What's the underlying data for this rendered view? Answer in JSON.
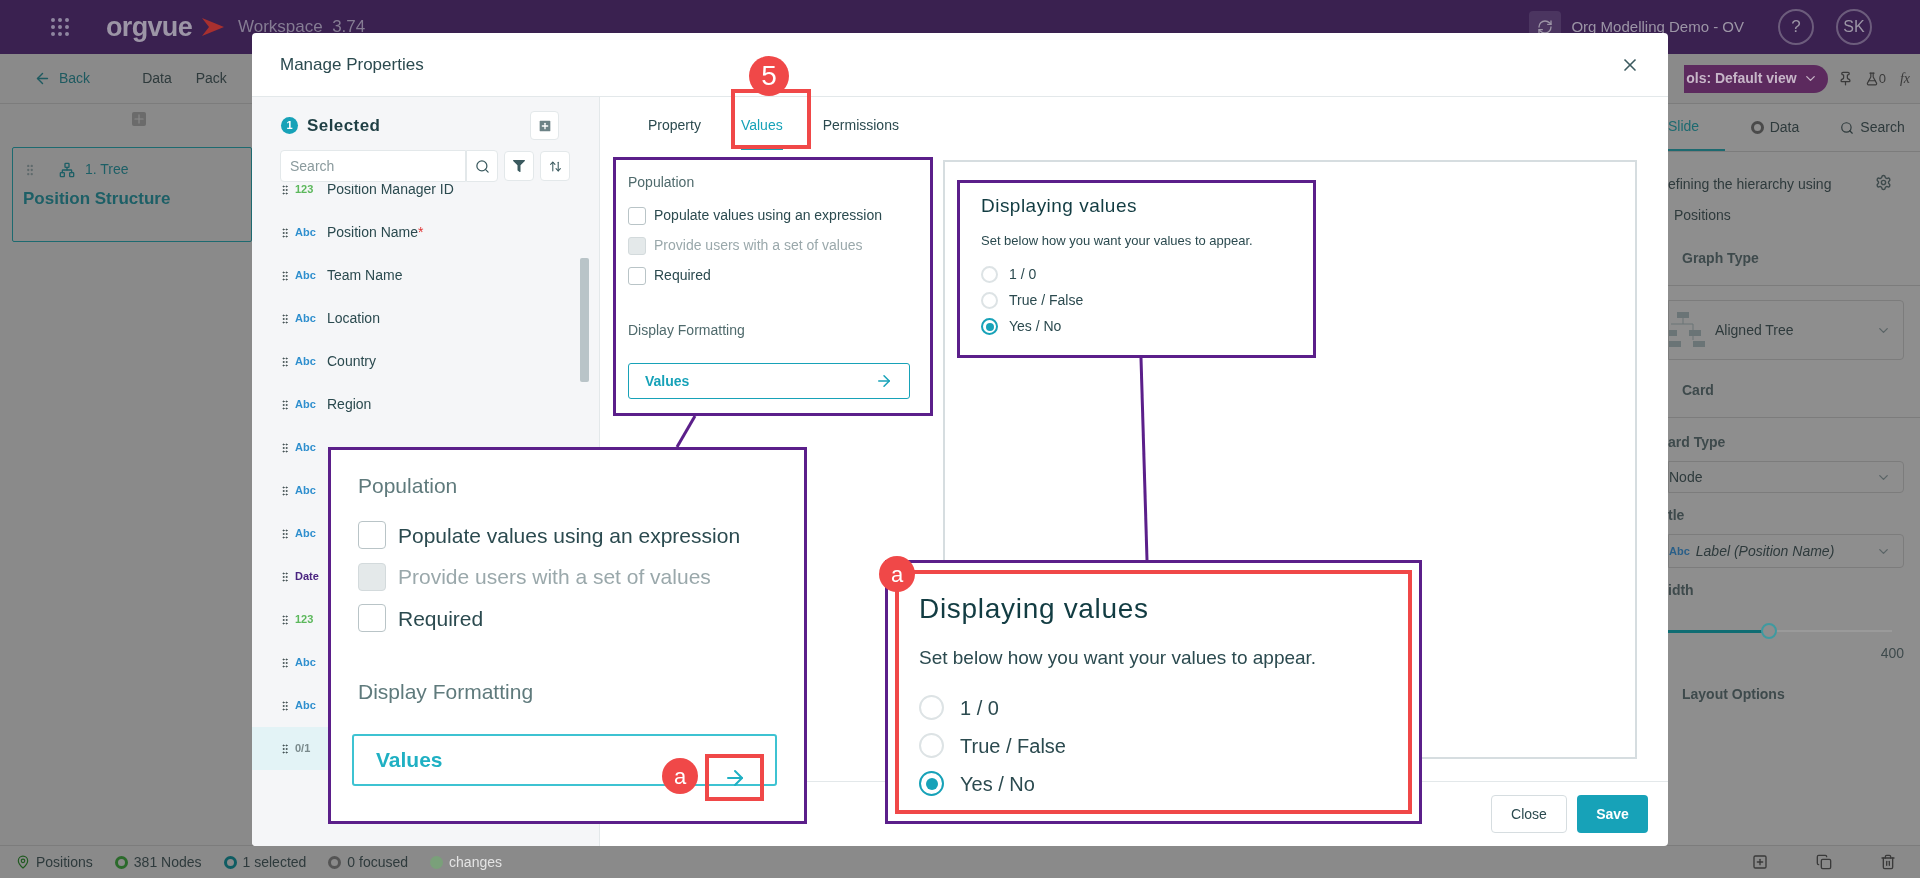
{
  "top_bar": {
    "logo": "orgvue",
    "workspace": "Workspace  3.74",
    "project": "Org Modelling Demo - OV",
    "help": "?",
    "avatar": "SK"
  },
  "toolbar": {
    "back": "Back",
    "menu": [
      "Data",
      "Pack"
    ],
    "view": "ols: Default view",
    "alerts": "0",
    "formula": "fx"
  },
  "canvas": {
    "card": {
      "title": "1. Tree",
      "name": "Position Structure"
    }
  },
  "right_panel": {
    "tabs": [
      {
        "label": "Slide",
        "selected": true
      },
      {
        "label": "Data",
        "selected": false
      },
      {
        "label": "Search",
        "selected": false
      }
    ],
    "hierarchy_text": "efining the hierarchy using",
    "hierarchy_value": "Positions",
    "graph_heading": "Graph Type",
    "graph_type": "Aligned Tree",
    "card_heading": "Card",
    "card_type_label": "ard Type",
    "card_type": "Node",
    "title_label": "tle",
    "title_tag": "Abc",
    "title_value": "Label (Position Name)",
    "width_label": "idth",
    "width": {
      "level": 0.45,
      "reading": "400"
    },
    "layout_heading": "Layout Options"
  },
  "status_bar": [
    {
      "kind": "positions",
      "label": "Positions",
      "disabled": false
    },
    {
      "kind": "nodes",
      "label": "381 Nodes",
      "disabled": false
    },
    {
      "kind": "selected",
      "label": "1 selected",
      "disabled": false
    },
    {
      "kind": "focused",
      "label": "0 focused",
      "disabled": false
    },
    {
      "kind": "changes",
      "label": "changes",
      "disabled": true
    }
  ],
  "modal": {
    "title": "Manage Properties",
    "selected_count": "1",
    "selected_label": "Selected",
    "search": {
      "placeholder": "Search"
    },
    "properties": [
      {
        "kind": "number",
        "type": "123",
        "name": "Position Manager ID",
        "selected": false
      },
      {
        "kind": "text",
        "type": "Abc",
        "name": "Position Name",
        "marker": "*",
        "selected": false
      },
      {
        "kind": "text",
        "type": "Abc",
        "name": "Team Name",
        "selected": false
      },
      {
        "kind": "text",
        "type": "Abc",
        "name": "Location",
        "selected": false
      },
      {
        "kind": "text",
        "type": "Abc",
        "name": "Country",
        "selected": false
      },
      {
        "kind": "text",
        "type": "Abc",
        "name": "Region",
        "selected": false
      },
      {
        "kind": "text",
        "type": "Abc",
        "selected": false
      },
      {
        "kind": "text",
        "type": "Abc",
        "selected": false
      },
      {
        "kind": "text",
        "type": "Abc",
        "selected": false
      },
      {
        "kind": "date",
        "type": "Date",
        "selected": false
      },
      {
        "kind": "number",
        "type": "123",
        "selected": false
      },
      {
        "kind": "text",
        "type": "Abc",
        "selected": false
      },
      {
        "kind": "text",
        "type": "Abc",
        "selected": false
      },
      {
        "kind": "boolean",
        "type": "0/1",
        "selected": true
      }
    ],
    "tabs": [
      {
        "label": "Property",
        "selected": false
      },
      {
        "label": "Values",
        "selected": true
      },
      {
        "label": "Permissions",
        "selected": false
      }
    ],
    "population": {
      "heading": "Population",
      "options": [
        {
          "label": "Populate values using an expression",
          "checked": false,
          "disabled": false
        },
        {
          "label": "Provide users with a set of values",
          "checked": false,
          "disabled": true
        },
        {
          "label": "Required",
          "checked": false,
          "disabled": false
        }
      ]
    },
    "formatting": {
      "heading": "Display Formatting",
      "button": "Values"
    },
    "display": {
      "title": "Displaying values",
      "hint": "Set below how you want your values to appear.",
      "options": [
        {
          "label": "1 / 0",
          "selected": false
        },
        {
          "label": "True / False",
          "selected": false
        },
        {
          "label": "Yes / No",
          "selected": true
        }
      ]
    },
    "buttons": [
      {
        "kind": "secondary",
        "label": "Close"
      },
      {
        "kind": "primary",
        "label": "Save"
      }
    ]
  },
  "annotations": {
    "step": "5",
    "callouts": [
      {
        "kind": "formatting",
        "badge": "a",
        "population": {
          "heading": "Population",
          "options": [
            {
              "label": "Populate values using an expression",
              "checked": false,
              "disabled": false
            },
            {
              "label": "Provide users with a set of values",
              "checked": false,
              "disabled": true
            },
            {
              "label": "Required",
              "checked": false,
              "disabled": false
            }
          ]
        },
        "formatting": {
          "heading": "Display Formatting",
          "button": "Values"
        }
      },
      {
        "kind": "display",
        "badge": "a",
        "display": {
          "title": "Displaying values",
          "hint": "Set below how you want your values to appear.",
          "options": [
            {
              "label": "1 / 0",
              "selected": false
            },
            {
              "label": "True / False",
              "selected": false
            },
            {
              "label": "Yes / No",
              "selected": true
            }
          ]
        }
      }
    ]
  }
}
